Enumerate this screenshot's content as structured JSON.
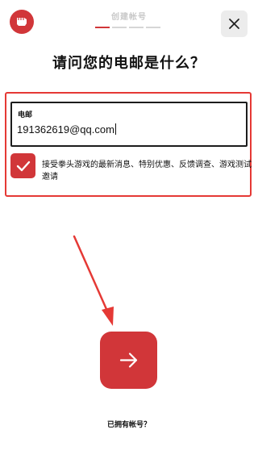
{
  "header": {
    "title": "创建帐号",
    "progress": {
      "current_step": 1,
      "total_steps": 4
    }
  },
  "logo": {
    "icon": "fist-logo-icon",
    "color": "#d13639"
  },
  "close_button": {
    "icon": "close-icon"
  },
  "page": {
    "title": "请问您的电邮是什么？"
  },
  "email_field": {
    "label": "电邮",
    "value": "191362619@qq.com"
  },
  "consent": {
    "checked": true,
    "text": "接受拳头游戏的最新消息、特别优惠、反馈调查、游戏测试邀请"
  },
  "next_button": {
    "icon": "arrow-right-icon"
  },
  "login_link": {
    "label": "已拥有帐号？"
  },
  "colors": {
    "accent": "#d13639",
    "annotation": "#e53935"
  }
}
